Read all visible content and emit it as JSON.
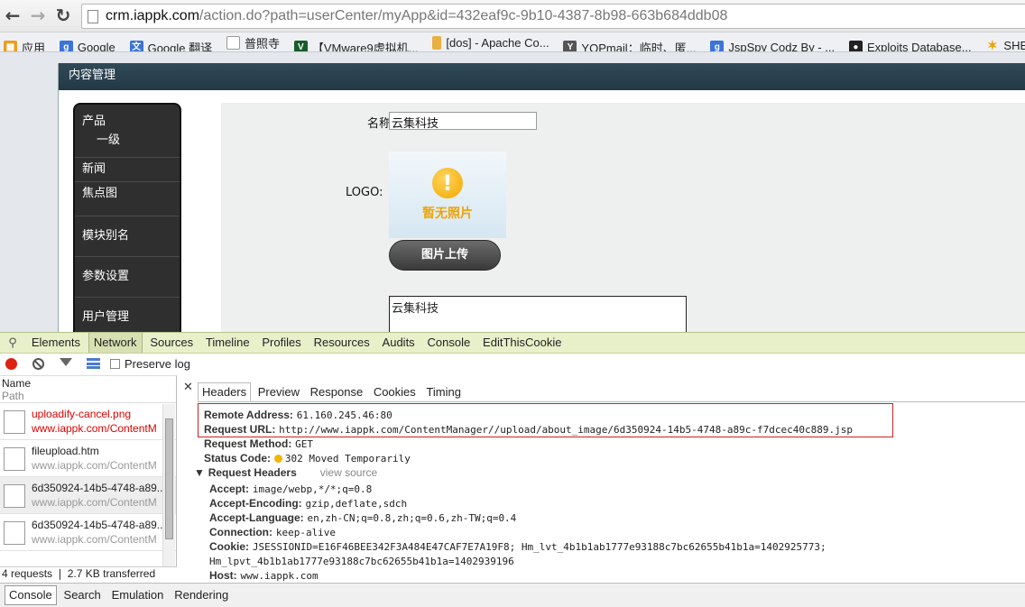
{
  "browser": {
    "url_domain": "crm.iappk.com",
    "url_path": "/action.do?path=userCenter/myApp&id=432eaf9c-9b10-4387-8b98-663b684ddb08",
    "bookmarks": [
      {
        "label": "应用",
        "icon": "apps-grid-icon",
        "color": "#e8a020"
      },
      {
        "label": "Google",
        "icon": "google-icon",
        "color": "#3b73d8"
      },
      {
        "label": "Google 翻译",
        "icon": "translate-icon",
        "color": "#3b73d8"
      },
      {
        "label": "普照寺",
        "icon": "page-icon",
        "color": "#ffffff"
      },
      {
        "label": "【VMware9虚拟机...",
        "icon": "vmware-icon",
        "color": "#1a5c2a"
      },
      {
        "label": "[dos] - Apache Co...",
        "icon": "bookmark-icon",
        "color": "#e8b040"
      },
      {
        "label": "YOPmail：临时、匿...",
        "icon": "yopmail-icon",
        "color": "#555555"
      },
      {
        "label": "JspSpy Codz By - ...",
        "icon": "google-icon",
        "color": "#3b73d8"
      },
      {
        "label": "Exploits Database...",
        "icon": "exploit-db-icon",
        "color": "#222222"
      },
      {
        "label": "SHENTOU",
        "icon": "star-icon",
        "color": "#f0a000"
      }
    ]
  },
  "page": {
    "panel_title": "内容管理",
    "menu": [
      "产品",
      "一级",
      "新闻",
      "焦点图",
      "模块别名",
      "参数设置",
      "用户管理"
    ],
    "form": {
      "name_label": "名称",
      "name_value": "云集科技",
      "logo_label": "LOGO:",
      "no_photo": "暂无照片",
      "upload_button": "图片上传",
      "description_value": "云集科技"
    }
  },
  "devtools": {
    "tabs": [
      "Elements",
      "Network",
      "Sources",
      "Timeline",
      "Profiles",
      "Resources",
      "Audits",
      "Console",
      "EditThisCookie"
    ],
    "active_tab": "Network",
    "preserve_log": "Preserve log",
    "list_header": {
      "name": "Name",
      "path": "Path"
    },
    "requests": [
      {
        "name": "uploadify-cancel.png",
        "domain": "www.iappk.com/ContentM",
        "error": true
      },
      {
        "name": "fileupload.htm",
        "domain": "www.iappk.com/ContentM",
        "error": false
      },
      {
        "name": "6d350924-14b5-4748-a89...",
        "domain": "www.iappk.com/ContentM",
        "error": false
      },
      {
        "name": "6d350924-14b5-4748-a89...",
        "domain": "www.iappk.com/ContentM",
        "error": false
      }
    ],
    "summary": "4 requests  ❘  2.7 KB transferred",
    "detail_tabs": [
      "Headers",
      "Preview",
      "Response",
      "Cookies",
      "Timing"
    ],
    "headers": {
      "remote_address_key": "Remote Address:",
      "remote_address": "61.160.245.46:80",
      "request_url_key": "Request URL:",
      "request_url": "http://www.iappk.com/ContentManager//upload/about_image/6d350924-14b5-4748-a89c-f7dcec40c889.jsp",
      "request_method_key": "Request Method:",
      "request_method": "GET",
      "status_code_key": "Status Code:",
      "status_code": "302 Moved Temporarily",
      "request_headers_title": "Request Headers",
      "view_source": "view source",
      "accept_key": "Accept:",
      "accept": "image/webp,*/*;q=0.8",
      "accept_encoding_key": "Accept-Encoding:",
      "accept_encoding": "gzip,deflate,sdch",
      "accept_language_key": "Accept-Language:",
      "accept_language": "en,zh-CN;q=0.8,zh;q=0.6,zh-TW;q=0.4",
      "connection_key": "Connection:",
      "connection": "keep-alive",
      "cookie_key": "Cookie:",
      "cookie": "JSESSIONID=E16F46BEE342F3A484E47CAF7E7A19F8; Hm_lvt_4b1b1ab1777e93188c7bc62655b41b1a=1402925773;",
      "cookie_cont": "Hm_lpvt_4b1b1ab1777e93188c7bc62655b41b1a=1402939196",
      "host_key": "Host:",
      "host": "www.iappk.com"
    },
    "drawer_tabs": [
      "Console",
      "Search",
      "Emulation",
      "Rendering"
    ]
  }
}
